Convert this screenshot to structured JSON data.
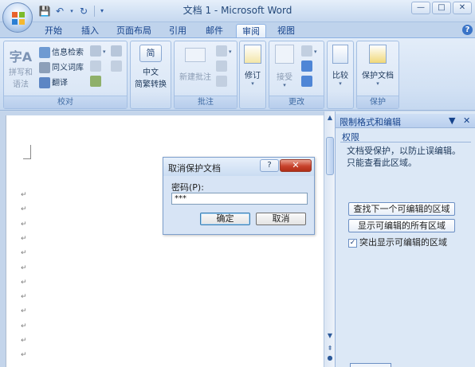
{
  "window": {
    "title": "文档 1 - Microsoft Word",
    "controls": [
      "—",
      "□",
      "✕"
    ]
  },
  "quick_access": [
    "save-icon",
    "undo-icon",
    "redo-icon",
    "customize-icon"
  ],
  "tabs": [
    {
      "label": "开始"
    },
    {
      "label": "插入"
    },
    {
      "label": "页面布局"
    },
    {
      "label": "引用"
    },
    {
      "label": "邮件"
    },
    {
      "label": "审阅",
      "active": true
    },
    {
      "label": "视图"
    }
  ],
  "ribbon": {
    "proofing": {
      "label": "校对",
      "spelling": "拼写和语法",
      "spelling_l1": "拼写和",
      "spelling_l2": "语法",
      "research": "信息检索",
      "thesaurus": "同义词库",
      "translate": "翻译"
    },
    "chinese": {
      "l1": "中文",
      "l2": "简繁转换"
    },
    "comments": {
      "label": "批注",
      "new_comment": "新建批注"
    },
    "tracking": {
      "track": "修订"
    },
    "changes": {
      "label": "更改",
      "accept": "接受"
    },
    "compare": {
      "label": "比较"
    },
    "protect": {
      "label": "保护",
      "protect_doc": "保护文档"
    }
  },
  "document": {
    "paragraph_mark": "↵"
  },
  "pane": {
    "title": "限制格式和编辑",
    "section": "权限",
    "message_l1": "文档受保护，以防止误编辑。",
    "message_l2": "只能查看此区域。",
    "find_next": "查找下一个可编辑的区域",
    "show_all": "显示可编辑的所有区域",
    "highlight": "突出显示可编辑的区域",
    "highlight_checked": true
  },
  "dialog": {
    "title": "取消保护文档",
    "help": "?",
    "close": "✕",
    "password_label": "密码(P):",
    "password_value": "***",
    "ok": "确定",
    "cancel": "取消"
  },
  "colors": {
    "accent": "#15428b",
    "close_red": "#c8422c"
  }
}
